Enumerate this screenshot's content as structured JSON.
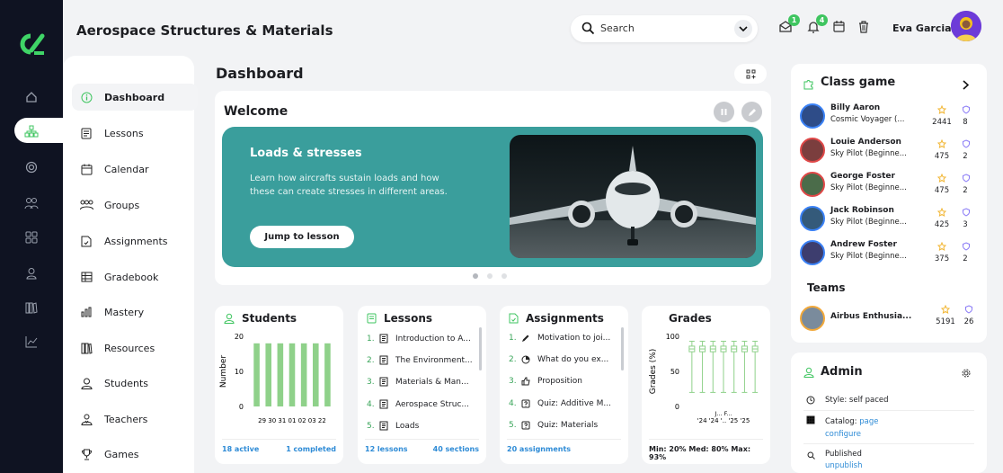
{
  "app": {
    "title": "Aerospace Structures & Materials"
  },
  "search": {
    "placeholder": "Search"
  },
  "notifications": {
    "messages_count": "1",
    "alerts_count": "4"
  },
  "user": {
    "name": "Eva Garcia"
  },
  "sidebar": {
    "items": [
      {
        "label": "Dashboard",
        "icon": "info-icon",
        "active": true
      },
      {
        "label": "Lessons",
        "icon": "book-icon"
      },
      {
        "label": "Calendar",
        "icon": "calendar-icon"
      },
      {
        "label": "Groups",
        "icon": "groups-icon"
      },
      {
        "label": "Assignments",
        "icon": "assignment-icon"
      },
      {
        "label": "Gradebook",
        "icon": "gradebook-icon"
      },
      {
        "label": "Mastery",
        "icon": "bars-icon"
      },
      {
        "label": "Resources",
        "icon": "library-icon"
      },
      {
        "label": "Students",
        "icon": "student-icon"
      },
      {
        "label": "Teachers",
        "icon": "teacher-icon"
      },
      {
        "label": "Games",
        "icon": "trophy-icon"
      }
    ]
  },
  "main": {
    "title": "Dashboard"
  },
  "welcome": {
    "title": "Welcome",
    "hero_title": "Loads & stresses",
    "hero_desc": "Learn how aircrafts sustain loads and how these can create stresses in different areas.",
    "hero_button": "Jump to lesson"
  },
  "students_card": {
    "title": "Students",
    "footer_left": "18 active",
    "footer_right": "1 completed"
  },
  "lessons_card": {
    "title": "Lessons",
    "items": [
      {
        "num": "1.",
        "text": "Introduction to A..."
      },
      {
        "num": "2.",
        "text": "The Environment..."
      },
      {
        "num": "3.",
        "text": "Materials & Man..."
      },
      {
        "num": "4.",
        "text": "Aerospace Struc..."
      },
      {
        "num": "5.",
        "text": "Loads"
      }
    ],
    "footer_left": "12 lessons",
    "footer_right": "40 sections"
  },
  "assignments_card": {
    "title": "Assignments",
    "items": [
      {
        "num": "1.",
        "text": "Motivation to joi..."
      },
      {
        "num": "2.",
        "text": "What do you ex..."
      },
      {
        "num": "3.",
        "text": "Proposition"
      },
      {
        "num": "4.",
        "text": "Quiz: Additive M..."
      },
      {
        "num": "5.",
        "text": "Quiz: Materials"
      }
    ],
    "footer_left": "20 assignments"
  },
  "grades_card": {
    "title": "Grades",
    "footer": "Min: 20% Med: 80% Max: 93%"
  },
  "chart_data": [
    {
      "type": "bar",
      "ylabel": "Number",
      "ylim": [
        0,
        20
      ],
      "yticks": [
        "20",
        "10",
        "0"
      ],
      "categories": [
        "29",
        "30",
        "31",
        "01",
        "02",
        "03",
        "22"
      ],
      "values": [
        18,
        18,
        18,
        18,
        18,
        18,
        18
      ],
      "tick_text": "29 30 31 01 02 03 22",
      "color": "#8fd18a"
    },
    {
      "type": "box",
      "ylabel": "Grades (%)",
      "ylim": [
        0,
        100
      ],
      "yticks": [
        "100",
        "50",
        "0"
      ],
      "categories": [
        "'24",
        "'24",
        "'..",
        "J..",
        "F..",
        "'25",
        "'25"
      ],
      "tick_row1": "J... F...",
      "tick_row2": "'24 '24 '.. '25 '25",
      "boxes": [
        {
          "min": 20,
          "q1": 78,
          "med": 82,
          "q3": 86,
          "max": 93
        },
        {
          "min": 20,
          "q1": 78,
          "med": 82,
          "q3": 86,
          "max": 93
        },
        {
          "min": 20,
          "q1": 78,
          "med": 82,
          "q3": 86,
          "max": 93
        },
        {
          "min": 20,
          "q1": 78,
          "med": 82,
          "q3": 86,
          "max": 93
        },
        {
          "min": 20,
          "q1": 78,
          "med": 82,
          "q3": 86,
          "max": 93
        },
        {
          "min": 20,
          "q1": 78,
          "med": 82,
          "q3": 86,
          "max": 93
        },
        {
          "min": 20,
          "q1": 78,
          "med": 82,
          "q3": 86,
          "max": 93
        }
      ],
      "color": "#8fd18a"
    }
  ],
  "class_game": {
    "title": "Class game",
    "players": [
      {
        "name": "Billy Aaron",
        "rank": "Cosmic Voyager (...",
        "points": "2441",
        "badges": "8",
        "ring": "#3b82f6"
      },
      {
        "name": "Louie Anderson",
        "rank": "Sky Pilot (Beginne...",
        "points": "475",
        "badges": "2",
        "ring": "#e04848"
      },
      {
        "name": "George Foster",
        "rank": "Sky Pilot (Beginne...",
        "points": "475",
        "badges": "2",
        "ring": "#e04848"
      },
      {
        "name": "Jack Robinson",
        "rank": "Sky Pilot (Beginne...",
        "points": "425",
        "badges": "3",
        "ring": "#3b82f6"
      },
      {
        "name": "Andrew Foster",
        "rank": "Sky Pilot (Beginne...",
        "points": "375",
        "badges": "2",
        "ring": "#3b82f6"
      }
    ],
    "teams_title": "Teams",
    "team": {
      "name": "Airbus Enthusia...",
      "points": "5191",
      "badges": "26"
    }
  },
  "admin": {
    "title": "Admin",
    "style": "Style: self paced",
    "catalog_label": "Catalog:",
    "catalog_link": "page",
    "catalog_action": "configure",
    "published_label": "Published",
    "published_action": "unpublish"
  }
}
